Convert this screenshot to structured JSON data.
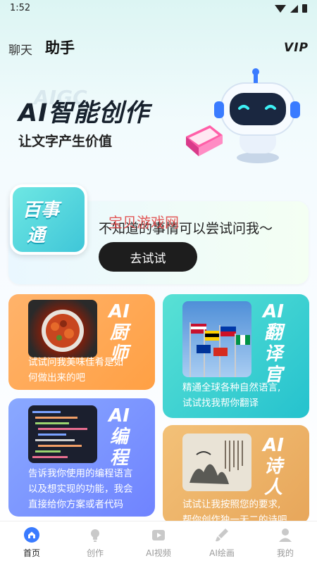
{
  "status_bar": {
    "time": "1:52"
  },
  "header": {
    "tab_chat": "聊天",
    "tab_assistant": "助手",
    "vip_label": "VIP"
  },
  "banner": {
    "title": "AI智能创作",
    "subtitle": "让文字产生价值"
  },
  "baishi_card": {
    "badge_line1": "百事",
    "badge_line2": "通",
    "text": "不知道的事情可以尝试问我～",
    "watermark": "宝贝游戏网",
    "button_label": "去试试"
  },
  "features": {
    "chef": {
      "title": "AI厨师",
      "title_lines": [
        "AI",
        "厨",
        "师"
      ],
      "desc_lines": [
        "试试问我美味佳肴是如",
        "何做出来的吧"
      ]
    },
    "translate": {
      "title": "AI翻译官",
      "title_lines": [
        "AI",
        "翻",
        "译",
        "官"
      ],
      "desc_lines": [
        "精通全球各种自然语言,",
        "试试找我帮你翻译"
      ]
    },
    "code": {
      "title": "AI编程",
      "title_lines": [
        "AI",
        "编",
        "程"
      ],
      "desc_lines": [
        "告诉我你使用的编程语言",
        "以及想实现的功能，我会",
        "直接给你方案或者代码"
      ]
    },
    "poet": {
      "title": "AI诗人",
      "title_lines": [
        "AI",
        "诗",
        "人"
      ],
      "desc_lines": [
        "试试让我按照您的要求,",
        "帮你创作独一无二的诗吧"
      ]
    }
  },
  "bottom_nav": [
    {
      "label": "首页",
      "icon": "home-icon",
      "active": true
    },
    {
      "label": "创作",
      "icon": "lightbulb-icon",
      "active": false
    },
    {
      "label": "AI视频",
      "icon": "video-icon",
      "active": false
    },
    {
      "label": "AI绘画",
      "icon": "brush-icon",
      "active": false
    },
    {
      "label": "我的",
      "icon": "user-icon",
      "active": false
    }
  ],
  "colors": {
    "accent_blue": "#3a7bff",
    "chef_card": "#ffa044",
    "translate_card": "#25c2ce",
    "code_card": "#6f83ff",
    "poet_card": "#e7a65a",
    "watermark": "#e03c3c"
  }
}
